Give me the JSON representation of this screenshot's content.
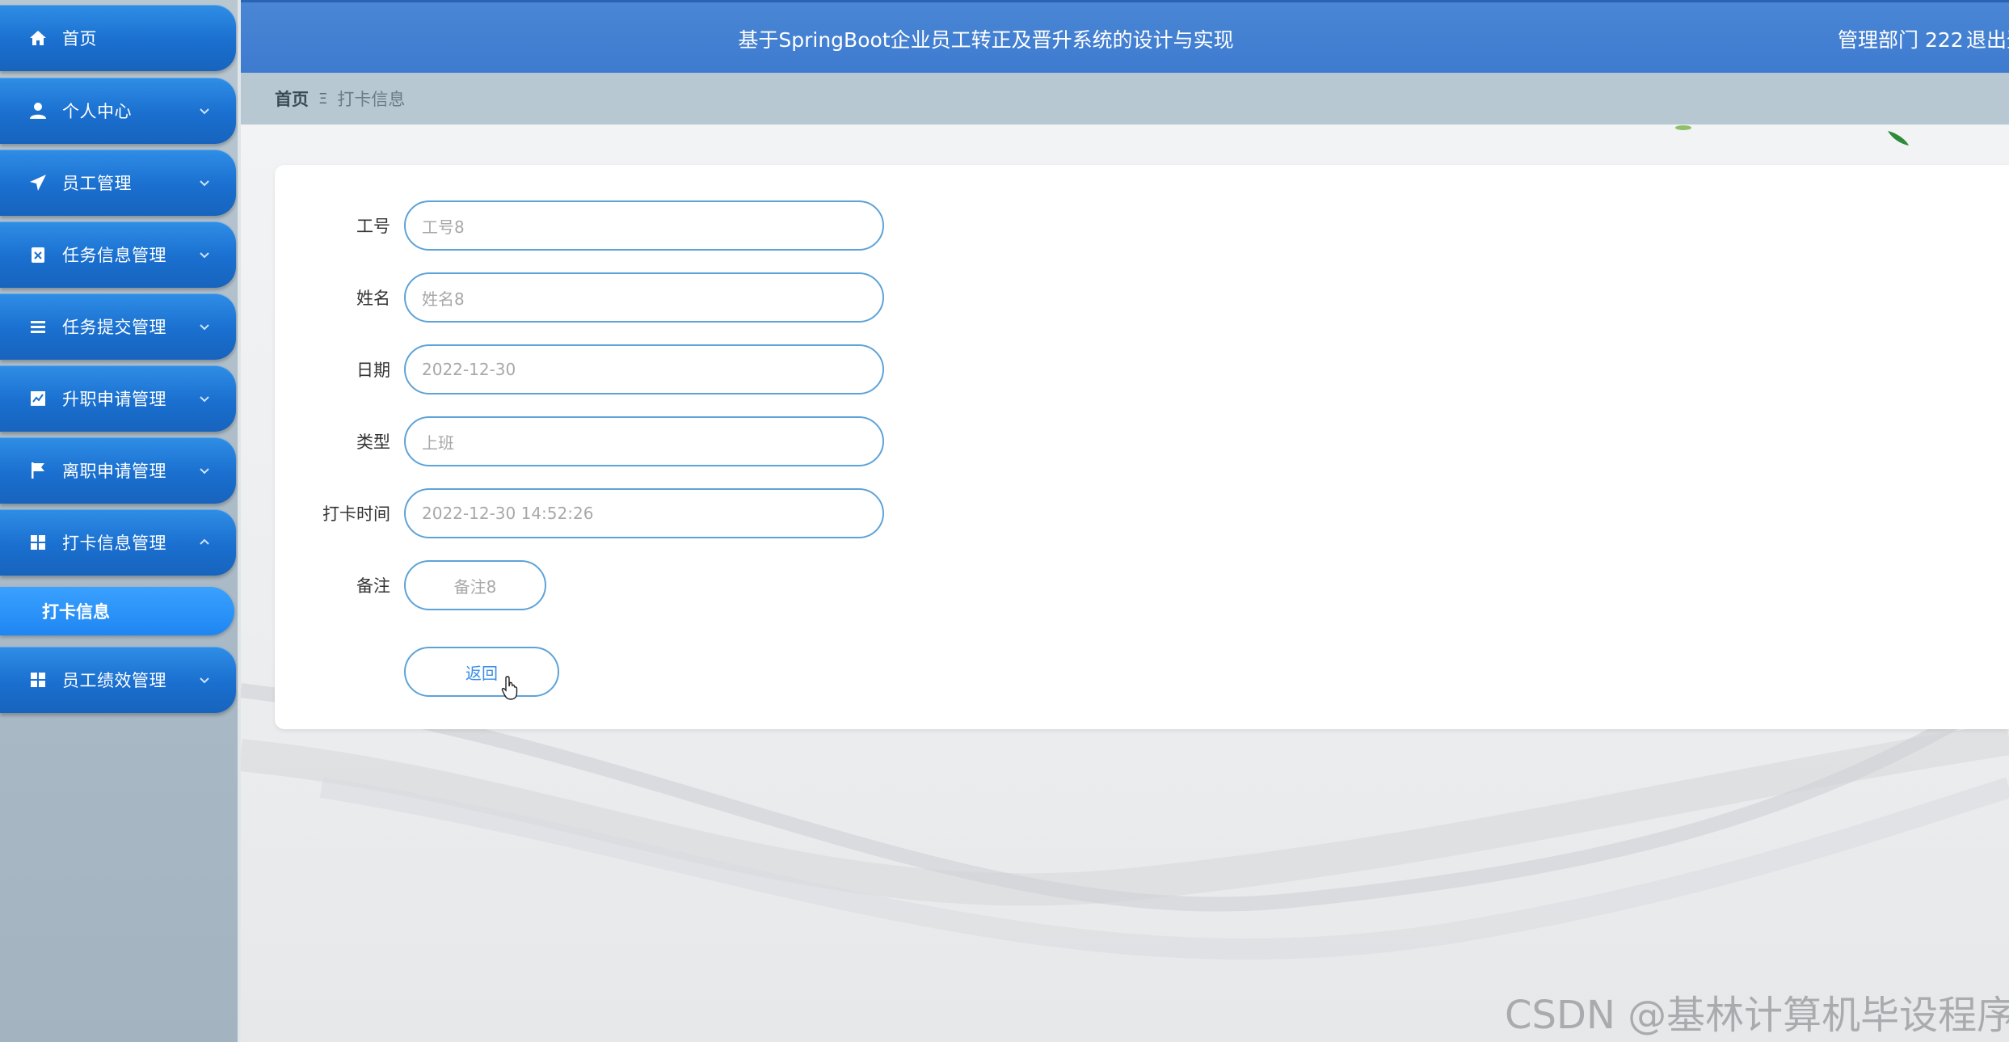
{
  "header": {
    "title": "基于SpringBoot企业员工转正及晋升系统的设计与实现",
    "user": "管理部门 222",
    "logout": "退出登"
  },
  "breadcrumb": {
    "home": "首页",
    "separator": "Ξ",
    "current": "打卡信息"
  },
  "sidebar": {
    "items": [
      {
        "label": "首页",
        "icon": "home-icon",
        "chevron": ""
      },
      {
        "label": "个人中心",
        "icon": "user-icon",
        "chevron": "down"
      },
      {
        "label": "员工管理",
        "icon": "send-icon",
        "chevron": "down"
      },
      {
        "label": "任务信息管理",
        "icon": "clipboard-icon",
        "chevron": "down"
      },
      {
        "label": "任务提交管理",
        "icon": "list-icon",
        "chevron": "down"
      },
      {
        "label": "升职申请管理",
        "icon": "chart-icon",
        "chevron": "down"
      },
      {
        "label": "离职申请管理",
        "icon": "flag-icon",
        "chevron": "down"
      },
      {
        "label": "打卡信息管理",
        "icon": "grid-icon",
        "chevron": "up"
      },
      {
        "label": "员工绩效管理",
        "icon": "grid-icon",
        "chevron": "down"
      }
    ],
    "active_sub": "打卡信息"
  },
  "form": {
    "fields": [
      {
        "label": "工号",
        "value": "工号8"
      },
      {
        "label": "姓名",
        "value": "姓名8"
      },
      {
        "label": "日期",
        "value": "2022-12-30"
      },
      {
        "label": "类型",
        "value": "上班"
      },
      {
        "label": "打卡时间",
        "value": "2022-12-30 14:52:26"
      },
      {
        "label": "备注",
        "value": "备注8"
      }
    ],
    "back_label": "返回"
  },
  "watermark": "CSDN @基林计算机毕设程序",
  "colors": {
    "menu_blue": "#1a6fcf",
    "header_blue": "#4a86d4",
    "input_border": "#5ea3d8",
    "link_blue": "#3a8ee6"
  }
}
